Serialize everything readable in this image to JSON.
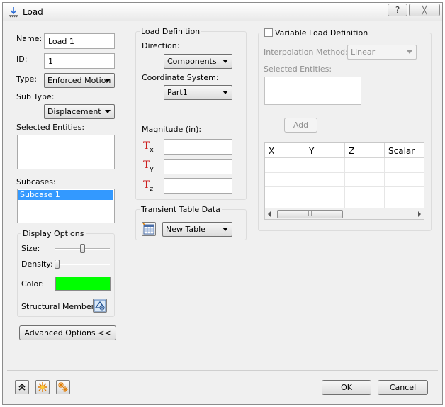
{
  "window": {
    "title": "Load",
    "help_label": "?",
    "close_label": "╳"
  },
  "left": {
    "name_label": "Name:",
    "name_value": "Load 1",
    "id_label": "ID:",
    "id_value": "1",
    "type_label": "Type:",
    "type_value": "Enforced Motion",
    "subtype_label": "Sub Type:",
    "subtype_value": "Displacement",
    "selected_entities_label": "Selected Entities:",
    "subcases_label": "Subcases:",
    "subcases_items": [
      "Subcase 1"
    ],
    "display_options": {
      "title": "Display Options",
      "size_label": "Size:",
      "size_level": 0.5,
      "density_label": "Density:",
      "density_level": 0.0,
      "color_label": "Color:",
      "color_value": "#00ff00",
      "structural_member_label": "Structural Member"
    },
    "advanced_button": "Advanced Options <<"
  },
  "load_definition": {
    "title": "Load Definition",
    "direction_label": "Direction:",
    "direction_value": "Components",
    "coord_label": "Coordinate System:",
    "coord_value": "Part1",
    "magnitude_label": "Magnitude (in):",
    "components": [
      {
        "letter": "T",
        "sub": "x",
        "value": ""
      },
      {
        "letter": "T",
        "sub": "y",
        "value": ""
      },
      {
        "letter": "T",
        "sub": "z",
        "value": ""
      }
    ]
  },
  "transient": {
    "title": "Transient Table Data",
    "value": "New Table"
  },
  "variable": {
    "checkbox_label": "Variable Load Definition",
    "checked": false,
    "interp_label": "Interpolation Method:",
    "interp_value": "Linear",
    "selected_label": "Selected Entities:",
    "add_button": "Add",
    "columns": [
      "X",
      "Y",
      "Z",
      "Scalar"
    ],
    "scroll_grip": "III"
  },
  "footer": {
    "ok": "OK",
    "cancel": "Cancel"
  },
  "colors": {
    "accent_selection": "#3399ff",
    "magnitude_red": "#cc1f1f"
  }
}
